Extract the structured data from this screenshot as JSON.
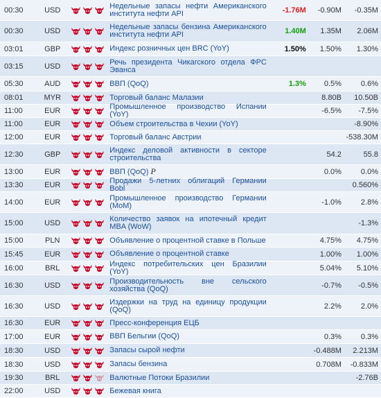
{
  "colors": {
    "row_even": "#eef3fa",
    "row_odd": "#dde7f4",
    "link": "#1a4f9c",
    "bull": "#c8102e",
    "negative": "#e02020",
    "positive": "#16a00f"
  },
  "rows": [
    {
      "time": "00:30",
      "currency": "USD",
      "importance": 3,
      "event": "Недельные запасы нефти Американского института нефти API",
      "actual": "-1.76M",
      "actual_color": "red",
      "forecast": "-0.90M",
      "previous": "-0.35M",
      "height": 30
    },
    {
      "time": "00:30",
      "currency": "USD",
      "importance": 3,
      "event": "Недельные запасы бензина Американского института нефти API",
      "actual": "1.40M",
      "actual_color": "green",
      "forecast": "1.35M",
      "previous": "2.06M",
      "height": 31
    },
    {
      "time": "03:01",
      "currency": "GBP",
      "importance": 3,
      "event": "Индекс розничных цен BRC (YoY)",
      "actual": "1.50%",
      "actual_color": "black",
      "forecast": "1.50%",
      "previous": "1.30%",
      "height": 20
    },
    {
      "time": "03:15",
      "currency": "USD",
      "importance": 3,
      "event": "Речь президента Чикагского отдела ФРС Эванса",
      "actual": "",
      "actual_color": "black",
      "forecast": "",
      "previous": "",
      "height": 30
    },
    {
      "time": "05:30",
      "currency": "AUD",
      "importance": 3,
      "event": "ВВП (QoQ)",
      "actual": "1.3%",
      "actual_color": "green",
      "forecast": "0.5%",
      "previous": "0.6%",
      "height": 21
    },
    {
      "time": "08:01",
      "currency": "MYR",
      "importance": 3,
      "event": "Торговый баланс Малазии",
      "actual": "",
      "actual_color": "black",
      "forecast": "8.80B",
      "previous": "10.50B",
      "height": 19
    },
    {
      "time": "11:00",
      "currency": "EUR",
      "importance": 3,
      "event": "Промышленное производство Испании (YoY)",
      "actual": "",
      "actual_color": "black",
      "forecast": "-6.5%",
      "previous": "-7.5%",
      "height": 19
    },
    {
      "time": "11:00",
      "currency": "EUR",
      "importance": 3,
      "event": "Объем строительства в Чехии (YoY)",
      "actual": "",
      "actual_color": "black",
      "forecast": "",
      "previous": "-8.90%",
      "height": 19
    },
    {
      "time": "12:00",
      "currency": "EUR",
      "importance": 3,
      "event": "Торговый баланс Австрии",
      "actual": "",
      "actual_color": "black",
      "forecast": "",
      "previous": "-538.30M",
      "height": 19
    },
    {
      "time": "12:30",
      "currency": "GBP",
      "importance": 3,
      "event": "Индекс деловой активности в секторе строительства",
      "actual": "",
      "actual_color": "black",
      "forecast": "54.2",
      "previous": "55.8",
      "height": 30
    },
    {
      "time": "13:00",
      "currency": "EUR",
      "importance": 3,
      "event": "ВВП (QoQ)",
      "tag": "P",
      "actual": "",
      "actual_color": "black",
      "forecast": "0.0%",
      "previous": "0.0%",
      "height": 20
    },
    {
      "time": "13:30",
      "currency": "EUR",
      "importance": 3,
      "event": "Продажи 5-летних облигаций Германии Bobl",
      "actual": "",
      "actual_color": "black",
      "forecast": "",
      "previous": "0.560%",
      "height": 19
    },
    {
      "time": "14:00",
      "currency": "EUR",
      "importance": 3,
      "event": "Промышленное производство Германии (MoM)",
      "actual": "",
      "actual_color": "black",
      "forecast": "-1.0%",
      "previous": "2.8%",
      "height": 30
    },
    {
      "time": "15:00",
      "currency": "USD",
      "importance": 3,
      "event": "Количество заявок на ипотечный кредит MBA (WoW)",
      "actual": "",
      "actual_color": "black",
      "forecast": "",
      "previous": "-1.3%",
      "height": 31
    },
    {
      "time": "15:00",
      "currency": "PLN",
      "importance": 3,
      "event": "Объявление о процентной ставке в Польше",
      "actual": "",
      "actual_color": "black",
      "forecast": "4.75%",
      "previous": "4.75%",
      "height": 19
    },
    {
      "time": "15:45",
      "currency": "EUR",
      "importance": 3,
      "event": "Объявление о процентной ставке",
      "actual": "",
      "actual_color": "black",
      "forecast": "1.00%",
      "previous": "1.00%",
      "height": 20
    },
    {
      "time": "16:00",
      "currency": "BRL",
      "importance": 3,
      "event": "Индекс потребительских цен Бразилии (YoY)",
      "actual": "",
      "actual_color": "black",
      "forecast": "5.04%",
      "previous": "5.10%",
      "height": 20
    },
    {
      "time": "16:30",
      "currency": "USD",
      "importance": 3,
      "event": "Производительность вне сельского хозяйства (QoQ)",
      "actual": "",
      "actual_color": "black",
      "forecast": "-0.7%",
      "previous": "-0.5%",
      "height": 30
    },
    {
      "time": "16:30",
      "currency": "USD",
      "importance": 3,
      "event": "Издержки на труд на единицу продукции (QoQ)",
      "actual": "",
      "actual_color": "black",
      "forecast": "2.2%",
      "previous": "2.0%",
      "height": 30
    },
    {
      "time": "16:30",
      "currency": "EUR",
      "importance": 3,
      "event": "Пресс-конференция ЕЦБ",
      "actual": "",
      "actual_color": "black",
      "forecast": "",
      "previous": "",
      "height": 19
    },
    {
      "time": "17:00",
      "currency": "EUR",
      "importance": 3,
      "event": "ВВП Бельгии (QoQ)",
      "actual": "",
      "actual_color": "black",
      "forecast": "0.3%",
      "previous": "0.3%",
      "height": 20
    },
    {
      "time": "18:30",
      "currency": "USD",
      "importance": 3,
      "event": "Запасы сырой нефти",
      "actual": "",
      "actual_color": "black",
      "forecast": "-0.488M",
      "previous": "2.213M",
      "height": 20
    },
    {
      "time": "18:30",
      "currency": "USD",
      "importance": 3,
      "event": "Запасы бензина",
      "actual": "",
      "actual_color": "black",
      "forecast": "0.708M",
      "previous": "-0.833M",
      "height": 20
    },
    {
      "time": "19:30",
      "currency": "BRL",
      "importance": 2,
      "event": "Валютные Потоки Бразилии",
      "actual": "",
      "actual_color": "black",
      "forecast": "",
      "previous": "-2.76B",
      "height": 19
    },
    {
      "time": "22:00",
      "currency": "USD",
      "importance": 3,
      "event": "Бежевая книга",
      "actual": "",
      "actual_color": "black",
      "forecast": "",
      "previous": "",
      "height": 19
    }
  ]
}
